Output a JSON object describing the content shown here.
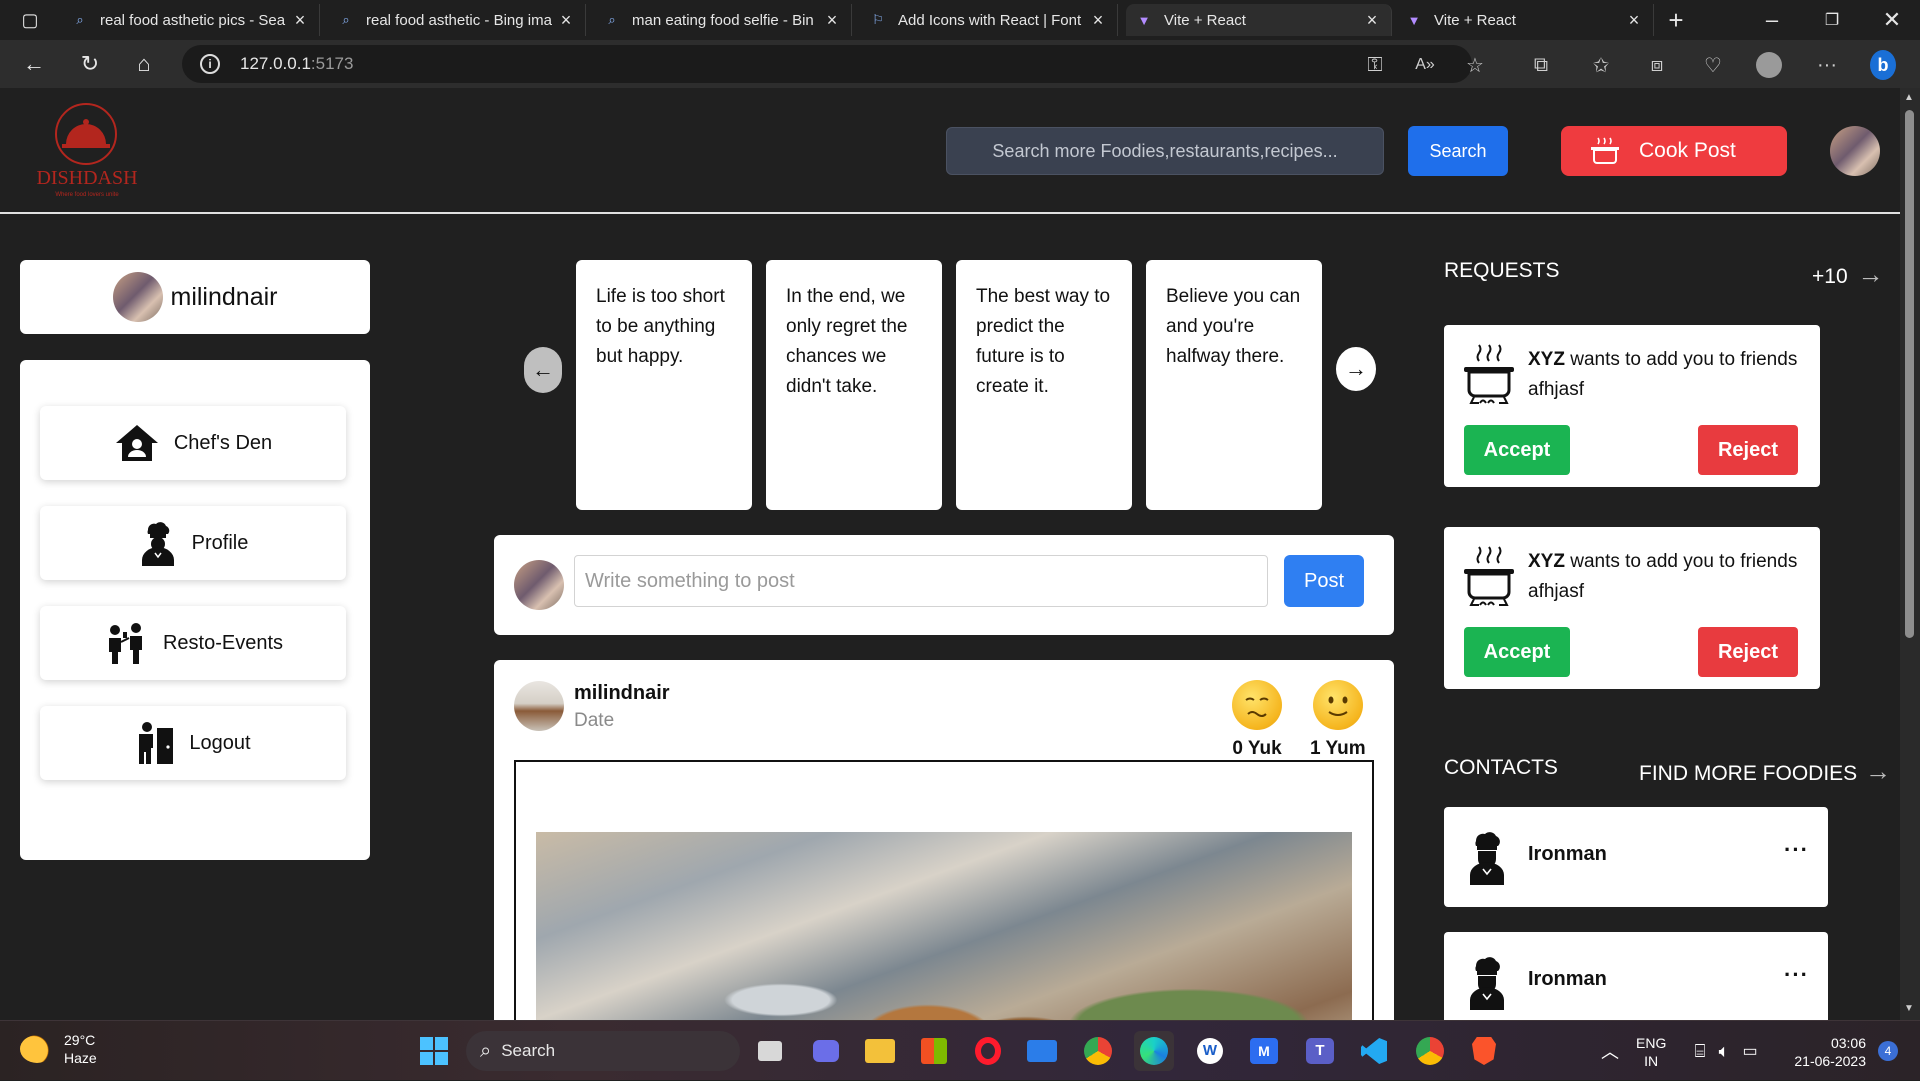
{
  "browser": {
    "tabs": [
      {
        "title": "real food asthetic pics - Sea",
        "active": false
      },
      {
        "title": "real food asthetic - Bing ima",
        "active": false
      },
      {
        "title": "man eating food selfie - Bin",
        "active": false
      },
      {
        "title": "Add Icons with React | Font",
        "active": false
      },
      {
        "title": "Vite + React",
        "active": true
      },
      {
        "title": "Vite + React",
        "active": false
      }
    ],
    "url_host": "127.0.0.1",
    "url_port": ":5173"
  },
  "header": {
    "logo_text": "DISHDASH",
    "logo_tagline": "Where food lovers unite",
    "search_placeholder": "Search more Foodies,restaurants,recipes...",
    "search_button": "Search",
    "cook_button": "Cook Post"
  },
  "sidebar": {
    "username": "milindnair",
    "items": [
      {
        "label": "Chef's Den",
        "icon": "house-user-icon"
      },
      {
        "label": "Profile",
        "icon": "chef-icon"
      },
      {
        "label": "Resto-Events",
        "icon": "people-event-icon"
      },
      {
        "label": "Logout",
        "icon": "door-exit-icon"
      }
    ]
  },
  "quotes": [
    "Life is too short to be anything but happy.",
    "In the end, we only regret the chances we didn't take.",
    "The best way to predict the future is to create it.",
    "Believe you can and you're halfway there."
  ],
  "composer": {
    "placeholder": "Write something to post",
    "post_button": "Post"
  },
  "feed": {
    "post": {
      "author": "milindnair",
      "date": "Date",
      "yuk_label": "0 Yuk",
      "yum_label": "1 Yum"
    }
  },
  "requests": {
    "title": "REQUESTS",
    "more": "+10",
    "items": [
      {
        "name": "XYZ",
        "text": " wants to add you to friends afhjasf",
        "accept": "Accept",
        "reject": "Reject"
      },
      {
        "name": "XYZ",
        "text": " wants to add you to friends afhjasf",
        "accept": "Accept",
        "reject": "Reject"
      }
    ]
  },
  "contacts": {
    "title": "CONTACTS",
    "find_more": "FIND MORE FOODIES",
    "items": [
      {
        "name": "Ironman"
      },
      {
        "name": "Ironman"
      }
    ]
  },
  "taskbar": {
    "temperature": "29°C",
    "condition": "Haze",
    "search_label": "Search",
    "lang_top": "ENG",
    "lang_bottom": "IN",
    "time": "03:06",
    "date": "21-06-2023",
    "notification_count": "4"
  },
  "colors": {
    "app_background": "#202020",
    "search_button": "#1f6feb",
    "cook_button": "#ef3b3f",
    "accept": "#1bb452",
    "reject": "#e83b3f",
    "logo": "#b3261e"
  }
}
